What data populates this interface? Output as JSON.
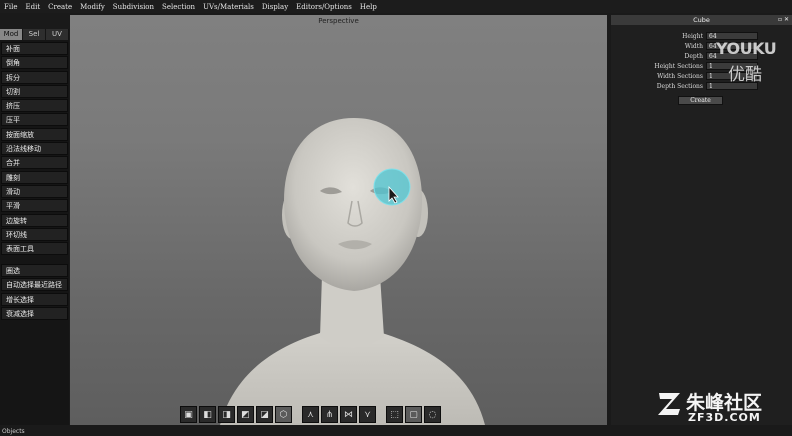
{
  "menu": [
    "File",
    "Edit",
    "Create",
    "Modify",
    "Subdivision",
    "Selection",
    "UVs/Materials",
    "Display",
    "Editors/Options",
    "Help"
  ],
  "left_tabs": [
    "Mod",
    "Sel",
    "UV"
  ],
  "tools": [
    "补面",
    "倒角",
    "拆分",
    "切割",
    "挤压",
    "压平",
    "按面缩放",
    "沿法线移动",
    "合并",
    "雕刻",
    "滑动",
    "平滑",
    "边旋转",
    "环切线",
    "表面工具"
  ],
  "select_tools": [
    "圈选",
    "自动选择最近路径",
    "增长选择",
    "衰减选择"
  ],
  "viewport": {
    "title": "Perspective"
  },
  "panel": {
    "title": "Cube",
    "rows": [
      {
        "label": "Height",
        "value": "64"
      },
      {
        "label": "Width",
        "value": "64"
      },
      {
        "label": "Depth",
        "value": "64"
      },
      {
        "label": "Height Sections",
        "value": "1"
      },
      {
        "label": "Width Sections",
        "value": "1"
      },
      {
        "label": "Depth Sections",
        "value": "1"
      }
    ],
    "create_label": "Create"
  },
  "watermarks": {
    "youku": "YOUKU",
    "youku_cn": "优酷",
    "zf3d": "朱峰社区",
    "zf3d_url": "ZF3D.COM"
  },
  "status": "Objects"
}
